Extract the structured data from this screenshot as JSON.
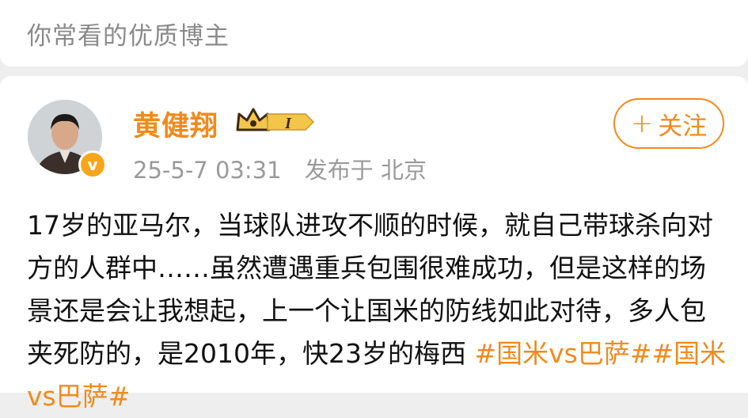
{
  "section": {
    "title": "你常看的优质博主"
  },
  "post": {
    "author": "黄健翔",
    "badge_text": "I",
    "timestamp": "25-5-7 03:31",
    "source": "发布于 北京",
    "follow_label": "关注",
    "follow_plus": "+",
    "verified_icon_char": "v",
    "text_main": "17岁的亚马尔，当球队进攻不顺的时候，就自己带球杀向对方的人群中……虽然遭遇重兵包围很难成功，但是这样的场景还是会让我想起，上一个让国米的防线如此对待，多人包夹死防的，是2010年，",
    "text_tail": "快23岁的梅西 ",
    "tags": [
      "#国米vs巴萨#",
      "#国米vs巴萨#"
    ]
  },
  "colors": {
    "accent": "#f08a1c",
    "muted": "#9a9a9a",
    "verified": "#f7a51a"
  }
}
